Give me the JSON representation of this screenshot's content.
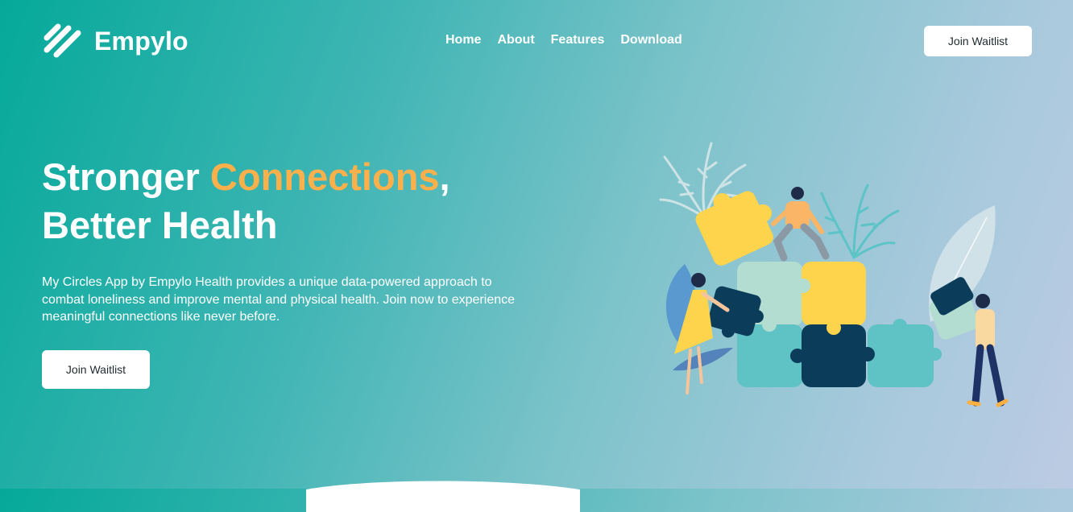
{
  "brand": {
    "name": "Empylo",
    "logo_icon": "stripes-icon"
  },
  "nav": {
    "items": [
      {
        "label": "Home"
      },
      {
        "label": "About"
      },
      {
        "label": "Features"
      },
      {
        "label": "Download"
      }
    ]
  },
  "header": {
    "cta_label": "Join Waitlist"
  },
  "hero": {
    "title_part1": "Stronger ",
    "title_accent": "Connections",
    "title_comma": ",",
    "title_line2": "Better Health",
    "description": "My Circles App by Empylo Health provides a unique data-powered approach to combat loneliness and improve mental and physical health. Join now to experience meaningful connections like never before.",
    "cta_label": "Join Waitlist",
    "illustration_icon": "puzzle-people-illustration"
  },
  "colors": {
    "accent": "#fbb04b",
    "gradient_start": "#05a99a",
    "gradient_end": "#bccbe3",
    "puzzle_yellow": "#fdd44c",
    "puzzle_navy": "#0b3d5b",
    "puzzle_teal": "#5fc3c6",
    "puzzle_mint": "#b3ddd0"
  }
}
